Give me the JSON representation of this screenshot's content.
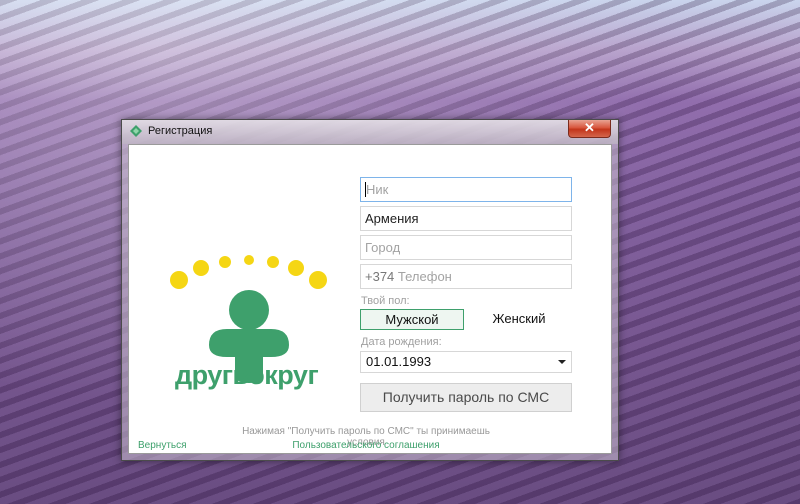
{
  "window": {
    "title": "Регистрация",
    "close_symbol": "✕"
  },
  "logo": {
    "brand_name": "другвокруг",
    "icon": "drugvokrug-logo-icon"
  },
  "form": {
    "nick_placeholder": "Ник",
    "country_value": "Армения",
    "city_placeholder": "Город",
    "phone_prefix": "+374",
    "phone_placeholder": "Телефон",
    "gender_label": "Твой пол:",
    "gender_male": "Мужской",
    "gender_female": "Женский",
    "gender_selected": "Мужской",
    "birthdate_label": "Дата рождения:",
    "birthdate_value": "01.01.1993",
    "sms_button": "Получить пароль по СМС"
  },
  "footer": {
    "terms_text": "Нажимая \"Получить пароль по СМС\" ты принимаешь условия",
    "terms_link": "Пользовательского соглашения",
    "back_link": "Вернуться"
  },
  "colors": {
    "brand_green": "#3ea06c",
    "accent_yellow": "#f5d614"
  }
}
